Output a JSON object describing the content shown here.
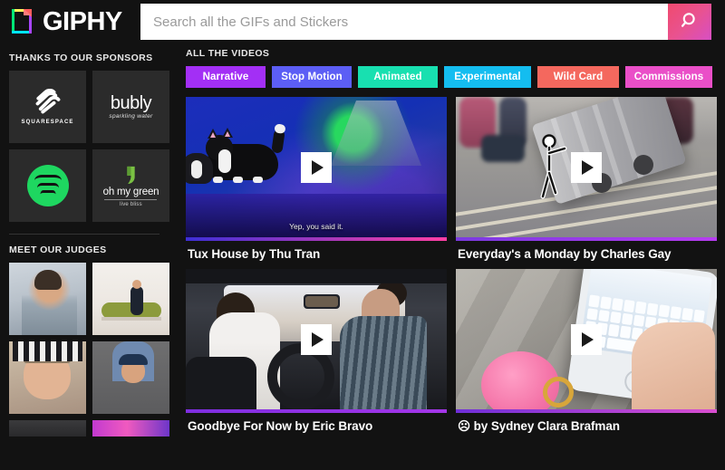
{
  "header": {
    "brand": "GIPHY",
    "logo_icon": "giphy-page-logo-icon",
    "search": {
      "placeholder": "Search all the GIFs and Stickers",
      "value": "",
      "button_icon": "search-icon",
      "button_gradient_start": "#f04a6e",
      "button_gradient_end": "#d74fc4"
    }
  },
  "sidebar": {
    "sponsors_heading": "THANKS TO OUR SPONSORS",
    "sponsors": [
      {
        "name": "Squarespace",
        "label": "SQUARESPACE",
        "icon": "squarespace-logo-icon"
      },
      {
        "name": "bubly",
        "label": "bubly",
        "sublabel": "sparkling water",
        "icon": "bubly-logo-icon"
      },
      {
        "name": "Spotify",
        "label": "",
        "icon": "spotify-logo-icon",
        "color": "#1ed760"
      },
      {
        "name": "oh my green",
        "label": "oh my green",
        "sublabel": "live bliss",
        "icon": "oh-my-green-leaf-icon",
        "color": "#7ac143"
      }
    ],
    "judges_heading": "MEET OUR JUDGES",
    "judges": [
      {
        "name": "judge-1",
        "alt": "bearded man in light shirt by window"
      },
      {
        "name": "judge-2",
        "alt": "woman seated on green chaise in white room"
      },
      {
        "name": "judge-3",
        "alt": "man pointing at his eye indoors"
      },
      {
        "name": "judge-4",
        "alt": "man in navy cap and blue t-shirt"
      },
      {
        "name": "judge-5",
        "alt": "partially visible photo"
      },
      {
        "name": "judge-6",
        "alt": "partially visible colorful photo"
      }
    ]
  },
  "main": {
    "heading": "ALL THE VIDEOS",
    "categories": [
      {
        "label": "Narrative",
        "color": "#a32ff5"
      },
      {
        "label": "Stop Motion",
        "color": "#5c5ef5"
      },
      {
        "label": "Animated",
        "color": "#18e0b0"
      },
      {
        "label": "Experimental",
        "color": "#14bdf0"
      },
      {
        "label": "Wild Card",
        "color": "#f4685e"
      },
      {
        "label": "Commissions",
        "color": "#ea4fc8"
      }
    ],
    "videos": [
      {
        "title": "Tux House by Thu Tran",
        "art": "cat",
        "subtitle": "Yep, you said it.",
        "bar_from": "#3d2fd6",
        "bar_to": "#ff3fa4",
        "play_icon": "play-icon"
      },
      {
        "title": "Everyday's a Monday by Charles Gay",
        "art": "suitcase",
        "subtitle": "",
        "bar_from": "#7a3ae0",
        "bar_to": "#b73cf0",
        "play_icon": "play-icon"
      },
      {
        "title": "Goodbye For Now by Eric Bravo",
        "art": "car",
        "subtitle": "",
        "bar_from": "#7e2ee0",
        "bar_to": "#a436e8",
        "play_icon": "play-icon"
      },
      {
        "title": "☹ by Sydney Clara Brafman",
        "art": "phone",
        "subtitle": "",
        "bar_from": "#6f2fd8",
        "bar_to": "#d94fd0",
        "play_icon": "play-icon"
      }
    ]
  }
}
